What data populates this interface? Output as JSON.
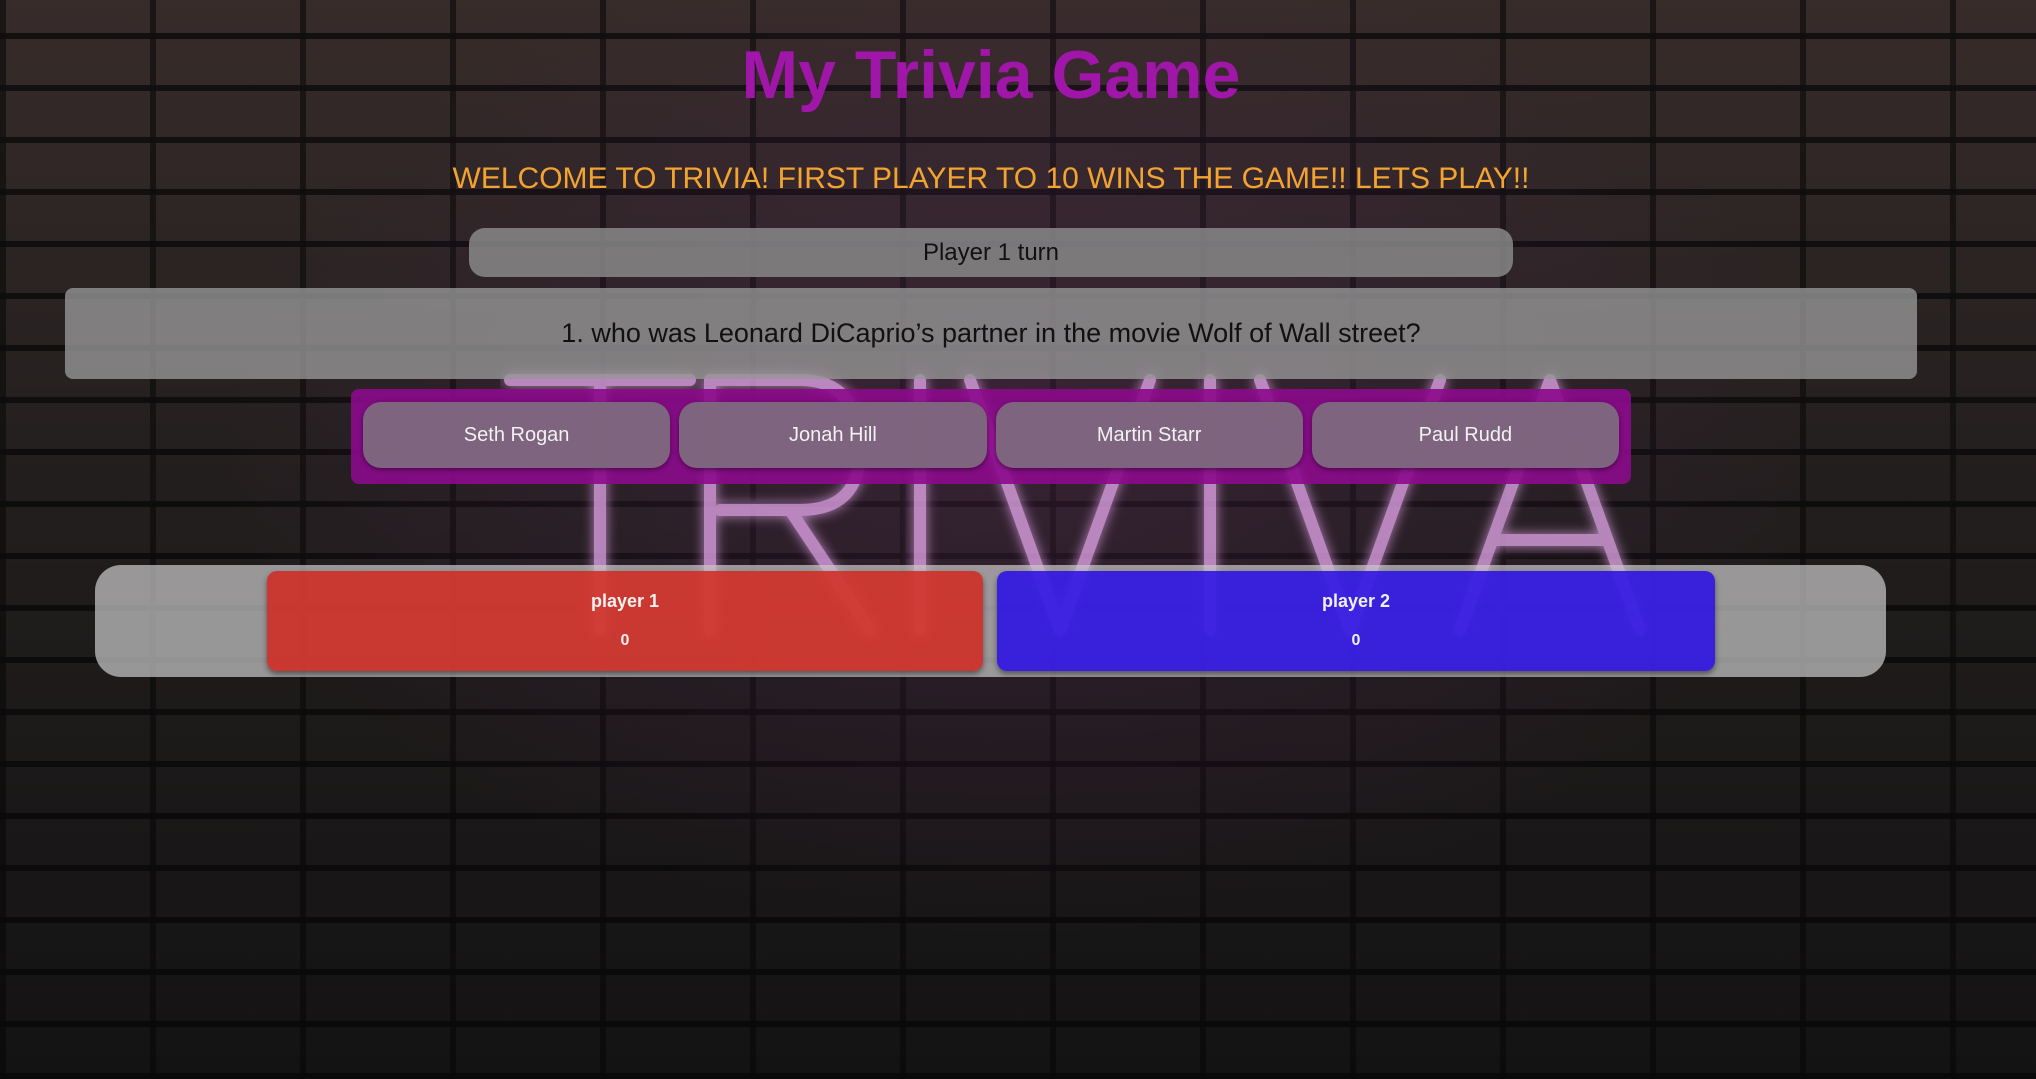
{
  "page": {
    "title": "My Trivia Game",
    "welcome": "WELCOME TO TRIVIA! FIRST PLAYER TO 10 WINS THE GAME!! LETS PLAY!!",
    "background_sign_text": "TRIVIA"
  },
  "turn": {
    "label": "Player 1 turn"
  },
  "question": {
    "text": "1. who was Leonard DiCaprio’s partner in the movie Wolf of Wall street?"
  },
  "answers": [
    {
      "label": "Seth Rogan"
    },
    {
      "label": "Jonah Hill"
    },
    {
      "label": "Martin Starr"
    },
    {
      "label": "Paul Rudd"
    }
  ],
  "players": [
    {
      "name": "player 1",
      "score": "0",
      "color": "#d2281e"
    },
    {
      "name": "player 2",
      "score": "0",
      "color": "#280ae6"
    }
  ],
  "colors": {
    "title": "#9f16a8",
    "welcome": "#f2a330",
    "answers_panel": "#8c0a8c"
  }
}
